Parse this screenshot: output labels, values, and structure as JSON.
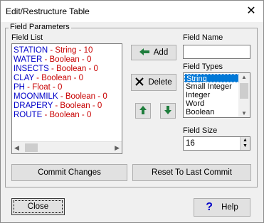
{
  "window": {
    "title": "Edit/Restructure Table",
    "close_glyph": "✕"
  },
  "group": {
    "label": "Field Parameters"
  },
  "field_list": {
    "label": "Field List",
    "items": [
      {
        "name": "STATION",
        "sep": " - ",
        "type": "String",
        "size": "10"
      },
      {
        "name": "WATER",
        "sep": " - ",
        "type": "Boolean",
        "size": "0"
      },
      {
        "name": "INSECTS",
        "sep": " - ",
        "type": "Boolean",
        "size": "0"
      },
      {
        "name": "CLAY",
        "sep": " - ",
        "type": "Boolean",
        "size": "0"
      },
      {
        "name": "PH",
        "sep": " - ",
        "type": "Float",
        "size": "0"
      },
      {
        "name": "MOONMILK",
        "sep": " - ",
        "type": "Boolean",
        "size": "0"
      },
      {
        "name": "DRAPERY",
        "sep": " - ",
        "type": "Boolean",
        "size": "0"
      },
      {
        "name": "ROUTE",
        "sep": " - ",
        "type": "Boolean",
        "size": "0"
      }
    ]
  },
  "buttons": {
    "add": "Add",
    "delete": "Delete",
    "commit": "Commit Changes",
    "reset": "Reset To Last Commit",
    "close": "Close",
    "help": "Help"
  },
  "field_name": {
    "label": "Field Name",
    "value": ""
  },
  "field_types": {
    "label": "Field Types",
    "options": [
      "String",
      "Small Integer",
      "Integer",
      "Word",
      "Boolean"
    ],
    "selected": "String"
  },
  "field_size": {
    "label": "Field Size",
    "value": "16"
  },
  "colors": {
    "name": "#0000c8",
    "type": "#c80000",
    "selection": "#0078d7",
    "arrow": "#1e7d3c"
  },
  "icons": {
    "add": "arrow-left-icon",
    "delete": "x-icon",
    "up": "arrow-up-icon",
    "down": "arrow-down-icon",
    "help": "question-icon"
  }
}
